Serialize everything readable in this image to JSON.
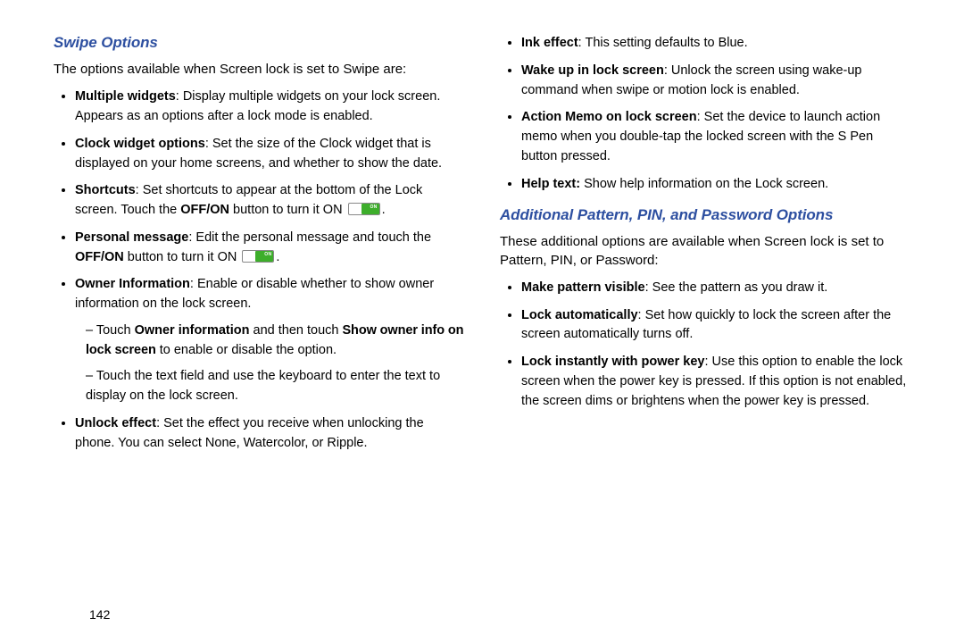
{
  "page_number": "142",
  "left": {
    "heading": "Swipe Options",
    "intro": "The options available when Screen lock is set to Swipe are:",
    "items": [
      {
        "label": "Multiple widgets",
        "text": ": Display multiple widgets on your lock screen. Appears as an options after a lock mode is enabled."
      },
      {
        "label": "Clock widget options",
        "text": ": Set the size of the Clock widget that is displayed on your home screens, and whether to show the date."
      },
      {
        "label": "Shortcuts",
        "text_pre": ": Set shortcuts to appear at the bottom of the Lock screen. Touch the ",
        "bold_mid": "OFF/ON",
        "text_post": " button to turn it ON ",
        "after": "."
      },
      {
        "label": "Personal message",
        "text_pre": ": Edit the personal message and touch the ",
        "bold_mid": "OFF/ON",
        "text_post": " button to turn it ON ",
        "after": "."
      },
      {
        "label": "Owner Information",
        "text": ": Enable or disable whether to show owner information on the lock screen.",
        "sub": [
          {
            "pre": "Touch ",
            "b1": "Owner information",
            "mid": " and then touch ",
            "b2": "Show owner info on lock screen",
            "post": " to enable or disable the option."
          },
          {
            "plain": "Touch the text field and use the keyboard to enter the text to display on the lock screen."
          }
        ]
      },
      {
        "label": "Unlock effect",
        "text": ": Set the effect you receive when unlocking the phone. You can select None, Watercolor, or Ripple."
      }
    ]
  },
  "right": {
    "top_items": [
      {
        "label": "Ink effect",
        "text": ": This setting defaults to Blue."
      },
      {
        "label": "Wake up in lock screen",
        "text": ": Unlock the screen using wake-up command when swipe or motion lock is enabled."
      },
      {
        "label": "Action Memo on lock screen",
        "text": ": Set the device to launch action memo when you double-tap the locked screen with the S Pen button pressed."
      },
      {
        "label": "Help text:",
        "text": " Show help information on the Lock screen."
      }
    ],
    "heading": "Additional Pattern, PIN, and Password Options",
    "intro": "These additional options are available when Screen lock is set to Pattern, PIN, or Password:",
    "items": [
      {
        "label": "Make pattern visible",
        "text": ": See the pattern as you draw it."
      },
      {
        "label": "Lock automatically",
        "text": ": Set how quickly to lock the screen after the screen automatically turns off."
      },
      {
        "label": "Lock instantly with power key",
        "text": ": Use this option to enable the lock screen when the power key is pressed. If this option is not enabled, the screen dims or brightens when the power key is pressed."
      }
    ]
  },
  "toggle_label": "ON"
}
